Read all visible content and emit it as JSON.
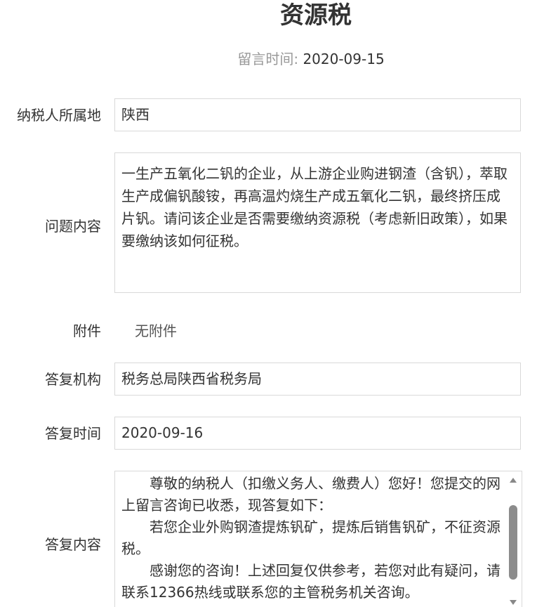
{
  "title": "资源税",
  "meta": {
    "label": "留言时间:",
    "date": "2020-09-15"
  },
  "form": {
    "location": {
      "label": "纳税人所属地",
      "value": "陕西"
    },
    "question": {
      "label": "问题内容",
      "value": "一生产五氧化二钒的企业，从上游企业购进钢渣（含钒），萃取生产成偏钒酸铵，再高温灼烧生产成五氧化二钒，最终挤压成片钒。请问该企业是否需要缴纳资源税（考虑新旧政策），如果要缴纳该如何征税。"
    },
    "attachment": {
      "label": "附件",
      "value": "无附件"
    },
    "agency": {
      "label": "答复机构",
      "value": "税务总局陕西省税务局"
    },
    "reply_time": {
      "label": "答复时间",
      "value": "2020-09-16"
    },
    "reply": {
      "label": "答复内容",
      "paragraphs": [
        "尊敬的纳税人（扣缴义务人、缴费人）您好！您提交的网上留言咨询已收悉，现答复如下：",
        "若您企业外购钢渣提炼钒矿，提炼后销售钒矿，不征资源税。",
        "感谢您的咨询！上述回复仅供参考，若您对此有疑问，请联系12366热线或联系您的主管税务机关咨询。"
      ]
    }
  }
}
